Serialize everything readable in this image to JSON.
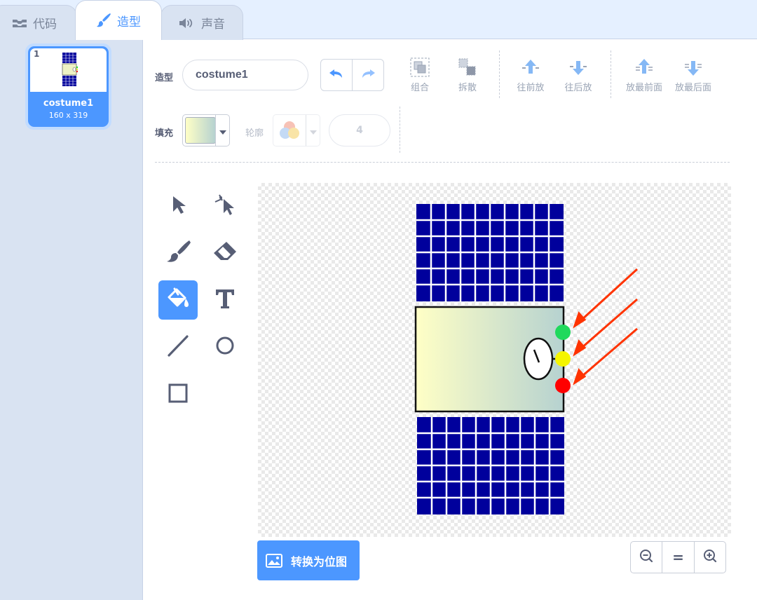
{
  "tabs": [
    {
      "label": "代码",
      "icon": "code-icon"
    },
    {
      "label": "造型",
      "icon": "brush-icon"
    },
    {
      "label": "声音",
      "icon": "speaker-icon"
    }
  ],
  "costume_list": [
    {
      "number": "1",
      "name": "costume1",
      "size": "160 x 319"
    }
  ],
  "toolbar": {
    "costume_label": "造型",
    "costume_name": "costume1",
    "group": "组合",
    "ungroup": "拆散",
    "forward": "往前放",
    "backward": "往后放",
    "front": "放最前面",
    "back": "放最后面",
    "fill_label": "填充",
    "outline_label": "轮廓",
    "outline_width": "4"
  },
  "colors": {
    "accent": "#4c97ff",
    "fill_gradient_start": "#ffffc6",
    "fill_gradient_end": "#b6d2d0",
    "panel_blue": "#00009c",
    "arrow_red": "#ff3300"
  },
  "tools": [
    "select-icon",
    "reshape-icon",
    "brush-icon",
    "eraser-icon",
    "fill-icon",
    "text-icon",
    "line-icon",
    "circle-icon",
    "rectangle-icon"
  ],
  "active_tool": "fill-icon",
  "canvas_indicators": [
    "green",
    "yellow",
    "red"
  ],
  "convert_button": "转换为位图",
  "zoom": {
    "out": "zoom-out-icon",
    "reset": "=",
    "in": "zoom-in-icon"
  }
}
